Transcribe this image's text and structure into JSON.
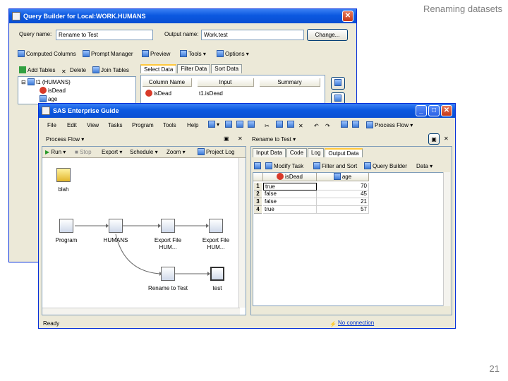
{
  "slide": {
    "title": "Renaming datasets",
    "number": "21"
  },
  "qb": {
    "title": "Query Builder for Local:WORK.HUMANS",
    "query_name_label": "Query name:",
    "query_name_value": "Rename to Test",
    "output_name_label": "Output name:",
    "output_name_value": "Work.test",
    "change_button": "Change...",
    "toolbar": [
      "Computed Columns",
      "Prompt Manager",
      "Preview",
      "Tools",
      "Options"
    ],
    "tree_toolbar": [
      "Add Tables",
      "Delete",
      "Join Tables"
    ],
    "tree_root": "t1 (HUMANS)",
    "tree_items": [
      "isDead",
      "age"
    ],
    "tabs": [
      "Select Data",
      "Filter Data",
      "Sort Data"
    ],
    "grid_headers": [
      "Column Name",
      "Input",
      "Summary"
    ],
    "grid_row": {
      "name": "isDead",
      "input": "t1.isDead"
    }
  },
  "eg": {
    "title": "SAS Enterprise Guide",
    "menu": [
      "File",
      "Edit",
      "View",
      "Tasks",
      "Program",
      "Tools",
      "Help"
    ],
    "process_flow_toolbar": "Process Flow",
    "left_dropdown": "Process Flow",
    "right_dropdown": "Rename to Test",
    "flow_toolbar": [
      "Run",
      "Stop",
      "Export",
      "Schedule",
      "Zoom",
      "Project Log"
    ],
    "nodes": {
      "blah": "blah",
      "program": "Program",
      "humans": "HUMANS",
      "export1": "Export File HUM...",
      "export2": "Export File HUM...",
      "rename": "Rename to Test",
      "test": "test"
    },
    "right_tabs": [
      "Input Data",
      "Code",
      "Log",
      "Output Data"
    ],
    "data_toolbar": [
      "Modify Task",
      "Filter and Sort",
      "Query Builder",
      "Data"
    ],
    "table": {
      "headers": [
        "isDead",
        "age"
      ],
      "rows": [
        {
          "n": "1",
          "isDead": "true",
          "age": "70"
        },
        {
          "n": "2",
          "isDead": "false",
          "age": "45"
        },
        {
          "n": "3",
          "isDead": "false",
          "age": "21"
        },
        {
          "n": "4",
          "isDead": "true",
          "age": "57"
        }
      ]
    },
    "status_left": "Ready",
    "status_right": "No connection"
  },
  "colors": {
    "titlebar": "#0b58e0",
    "window_bg": "#ece9d8",
    "accent_tab": "#ffc83c"
  }
}
